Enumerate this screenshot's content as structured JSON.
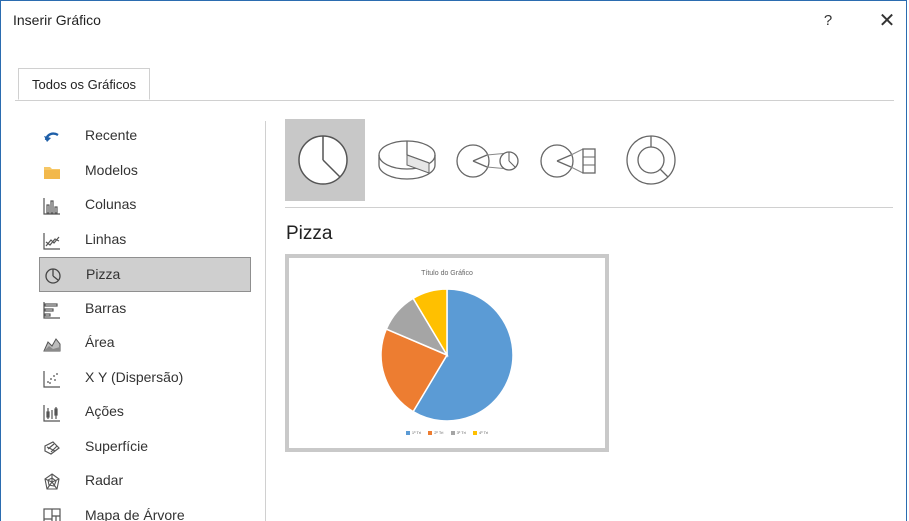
{
  "window": {
    "title": "Inserir Gráfico",
    "help_label": "?",
    "close_label": "✕"
  },
  "tabs": [
    {
      "label": "Todos os Gráficos"
    }
  ],
  "sidebar": {
    "items": [
      {
        "label": "Recente",
        "icon": "recent-icon"
      },
      {
        "label": "Modelos",
        "icon": "folder-icon"
      },
      {
        "label": "Colunas",
        "icon": "column-chart-icon"
      },
      {
        "label": "Linhas",
        "icon": "line-chart-icon"
      },
      {
        "label": "Pizza",
        "icon": "pie-chart-icon",
        "selected": true
      },
      {
        "label": "Barras",
        "icon": "bar-chart-icon"
      },
      {
        "label": "Área",
        "icon": "area-chart-icon"
      },
      {
        "label": "X Y (Dispersão)",
        "icon": "scatter-chart-icon"
      },
      {
        "label": "Ações",
        "icon": "stock-chart-icon"
      },
      {
        "label": "Superfície",
        "icon": "surface-chart-icon"
      },
      {
        "label": "Radar",
        "icon": "radar-chart-icon"
      },
      {
        "label": "Mapa de Árvore",
        "icon": "treemap-chart-icon"
      }
    ]
  },
  "subtypes": [
    {
      "name": "pie",
      "icon": "pie-icon",
      "selected": true
    },
    {
      "name": "pie-3d",
      "icon": "pie-3d-icon"
    },
    {
      "name": "pie-of-pie",
      "icon": "pie-of-pie-icon"
    },
    {
      "name": "bar-of-pie",
      "icon": "bar-of-pie-icon"
    },
    {
      "name": "doughnut",
      "icon": "doughnut-icon"
    }
  ],
  "section": {
    "title": "Pizza"
  },
  "preview": {
    "chart_title": "Título do Gráfico",
    "legend_items": [
      "1º Tri",
      "2º Tri",
      "3º Tri",
      "4º Tri"
    ]
  },
  "colors": {
    "accent": "#2b6cb0",
    "series": [
      "#5b9bd5",
      "#ed7d31",
      "#a5a5a5",
      "#ffc000"
    ]
  },
  "chart_data": {
    "type": "pie",
    "title": "Título do Gráfico",
    "categories": [
      "1º Tri",
      "2º Tri",
      "3º Tri",
      "4º Tri"
    ],
    "values": [
      8.2,
      3.2,
      1.4,
      1.2
    ],
    "colors": [
      "#5b9bd5",
      "#ed7d31",
      "#a5a5a5",
      "#ffc000"
    ],
    "legend": "bottom"
  }
}
